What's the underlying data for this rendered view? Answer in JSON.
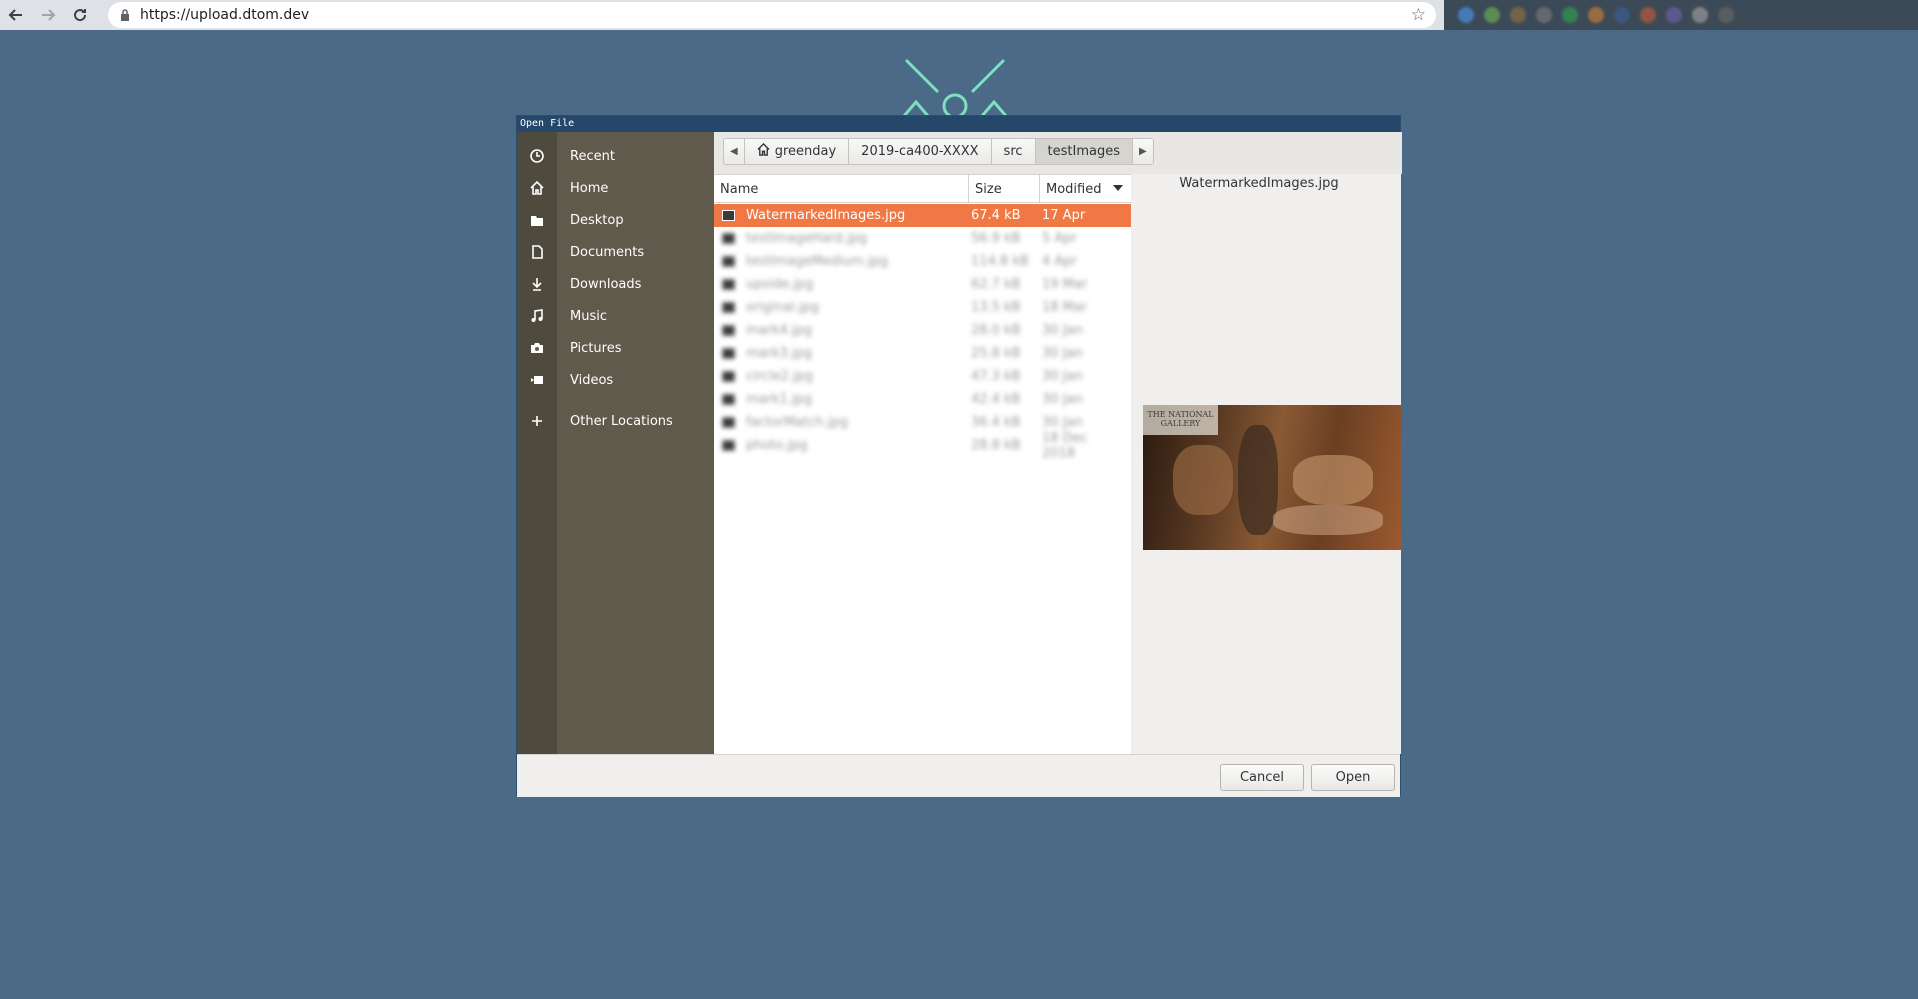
{
  "browser": {
    "url": "https://upload.dtom.dev",
    "back_icon": "back-arrow-icon",
    "forward_icon": "forward-arrow-icon",
    "reload_icon": "reload-icon",
    "bookmark_icon": "star-icon"
  },
  "dialog": {
    "title": "Open File",
    "sidebar": {
      "items": [
        {
          "label": "Recent",
          "icon": "clock-icon"
        },
        {
          "label": "Home",
          "icon": "home-icon"
        },
        {
          "label": "Desktop",
          "icon": "folder-icon"
        },
        {
          "label": "Documents",
          "icon": "document-icon"
        },
        {
          "label": "Downloads",
          "icon": "download-icon"
        },
        {
          "label": "Music",
          "icon": "music-icon"
        },
        {
          "label": "Pictures",
          "icon": "camera-icon"
        },
        {
          "label": "Videos",
          "icon": "video-icon"
        },
        {
          "label": "Other Locations",
          "icon": "plus-icon"
        }
      ]
    },
    "pathbar": {
      "crumbs": [
        "greenday",
        "2019-ca400-XXXX",
        "src",
        "testImages"
      ]
    },
    "filelist": {
      "headers": {
        "name": "Name",
        "size": "Size",
        "modified": "Modified"
      },
      "selected_file": {
        "name": "WatermarkedImages.jpg",
        "size": "67.4 kB",
        "modified": "17 Apr"
      },
      "blurred_rows": [
        {
          "name": "testImageHard.jpg",
          "size": "56.9 kB",
          "modified": "5 Apr"
        },
        {
          "name": "testImageMedium.jpg",
          "size": "114.8 kB",
          "modified": "4 Apr"
        },
        {
          "name": "upside.jpg",
          "size": "62.7 kB",
          "modified": "19 Mar"
        },
        {
          "name": "original.jpg",
          "size": "13.5 kB",
          "modified": "18 Mar"
        },
        {
          "name": "mark4.jpg",
          "size": "28.0 kB",
          "modified": "30 Jan"
        },
        {
          "name": "mark3.jpg",
          "size": "25.8 kB",
          "modified": "30 Jan"
        },
        {
          "name": "circle2.jpg",
          "size": "47.3 kB",
          "modified": "30 Jan"
        },
        {
          "name": "mark1.jpg",
          "size": "42.4 kB",
          "modified": "30 Jan"
        },
        {
          "name": "factorMatch.jpg",
          "size": "36.4 kB",
          "modified": "30 Jan"
        },
        {
          "name": "photo.jpg",
          "size": "28.8 kB",
          "modified": "18 Dec 2018"
        }
      ]
    },
    "preview": {
      "filename": "WatermarkedImages.jpg",
      "watermark_text": "THE NATIONAL GALLERY"
    },
    "buttons": {
      "cancel": "Cancel",
      "open": "Open"
    }
  }
}
